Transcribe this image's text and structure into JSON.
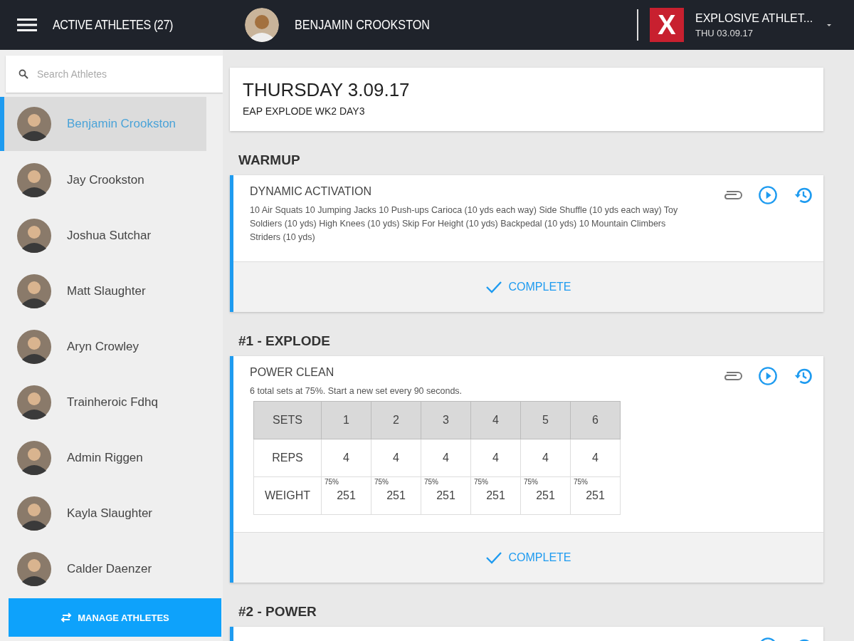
{
  "header": {
    "title": "ACTIVE ATHLETES (27)",
    "athlete_name": "BENJAMIN CROOKSTON",
    "logo_text": "X",
    "program_name": "EXPLOSIVE ATHLET...",
    "date": "THU 03.09.17"
  },
  "sidebar": {
    "search_placeholder": "Search Athletes",
    "athletes": [
      {
        "name": "Benjamin Crookston",
        "selected": true
      },
      {
        "name": "Jay Crookston",
        "selected": false
      },
      {
        "name": "Joshua Sutchar",
        "selected": false
      },
      {
        "name": "Matt Slaughter",
        "selected": false
      },
      {
        "name": "Aryn Crowley",
        "selected": false
      },
      {
        "name": "Trainheroic Fdhq",
        "selected": false
      },
      {
        "name": "Admin Riggen",
        "selected": false
      },
      {
        "name": "Kayla Slaughter",
        "selected": false
      },
      {
        "name": "Calder Daenzer",
        "selected": false
      }
    ],
    "manage_button": "MANAGE ATHLETES"
  },
  "day": {
    "title": "THURSDAY 3.09.17",
    "subtitle": "EAP EXPLODE WK2 DAY3"
  },
  "sections": [
    {
      "heading": "WARMUP",
      "exercises": [
        {
          "kind": "text",
          "name": "DYNAMIC ACTIVATION",
          "description": "10 Air Squats 10 Jumping Jacks 10 Push-ups Carioca (10 yds each way) Side Shuffle (10 yds each way) Toy Soldiers (10 yds) High Knees (10 yds) Skip For Height (10 yds) Backpedal (10 yds) 10 Mountain Climbers Striders (10 yds)",
          "complete_label": "COMPLETE"
        }
      ]
    },
    {
      "heading": "#1 - EXPLODE",
      "exercises": [
        {
          "kind": "table",
          "name": "POWER CLEAN",
          "description": "6 total sets at 75%. Start a new set every 90 seconds.",
          "table": {
            "header": [
              "SETS",
              "1",
              "2",
              "3",
              "4",
              "5",
              "6"
            ],
            "rows": [
              {
                "label": "REPS",
                "cells": [
                  {
                    "value": "4"
                  },
                  {
                    "value": "4"
                  },
                  {
                    "value": "4"
                  },
                  {
                    "value": "4"
                  },
                  {
                    "value": "4"
                  },
                  {
                    "value": "4"
                  }
                ]
              },
              {
                "label": "WEIGHT",
                "cells": [
                  {
                    "percent": "75%",
                    "value": "251"
                  },
                  {
                    "percent": "75%",
                    "value": "251"
                  },
                  {
                    "percent": "75%",
                    "value": "251"
                  },
                  {
                    "percent": "75%",
                    "value": "251"
                  },
                  {
                    "percent": "75%",
                    "value": "251"
                  },
                  {
                    "percent": "75%",
                    "value": "251"
                  }
                ]
              }
            ]
          },
          "complete_label": "COMPLETE"
        }
      ]
    },
    {
      "heading": "#2 - POWER",
      "exercises": [
        {
          "kind": "partial"
        }
      ]
    }
  ]
}
